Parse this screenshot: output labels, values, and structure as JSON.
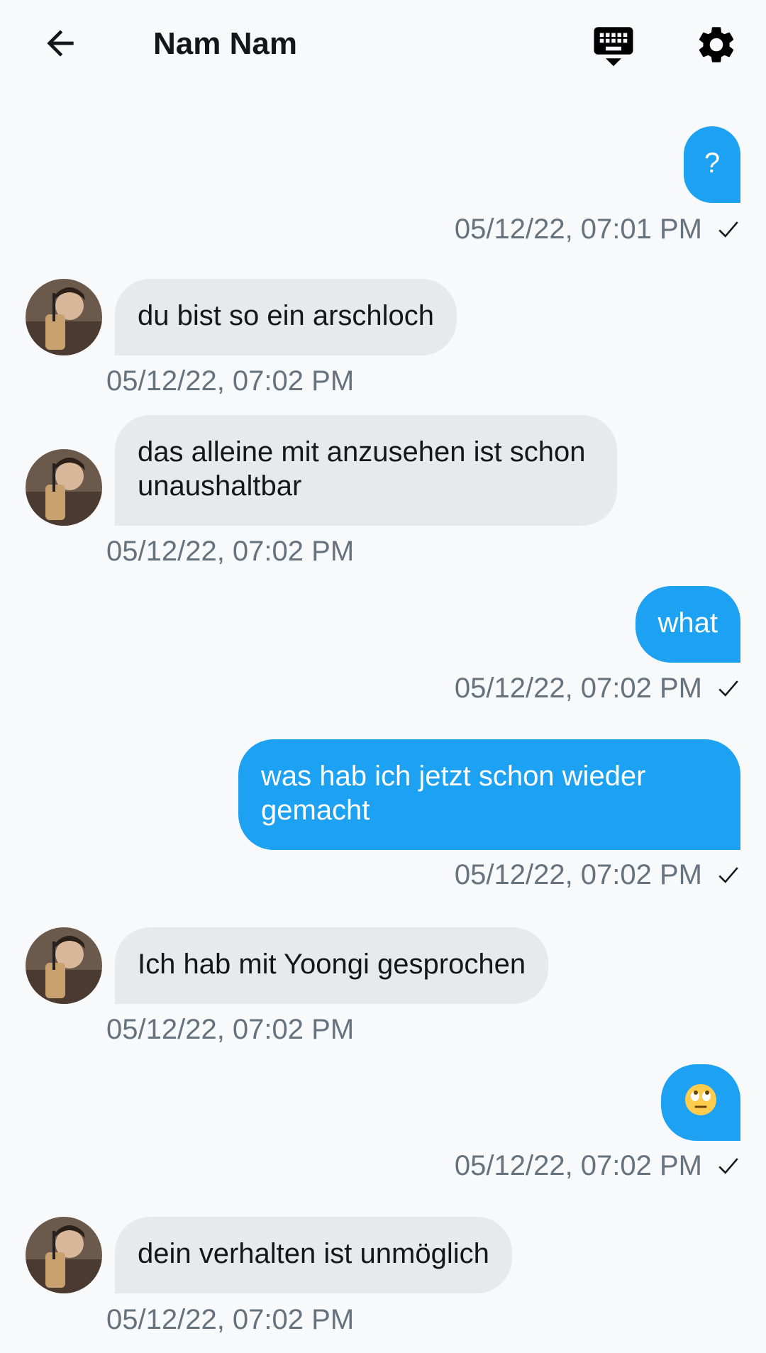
{
  "header": {
    "title": "Nam Nam",
    "back_icon": "arrow-left-icon",
    "keyboard_icon": "keyboard-hide-icon",
    "settings_icon": "gear-icon"
  },
  "colors": {
    "accent": "#1DA1F2",
    "incoming_bubble": "#E6EAED",
    "timestamp": "#66727E",
    "background": "#F7F9FA"
  },
  "messages": [
    {
      "direction": "out",
      "text": "?",
      "timestamp": "05/12/22, 07:01 PM",
      "sent": true
    },
    {
      "direction": "in",
      "text": "du bist so ein arschloch",
      "timestamp": "05/12/22, 07:02 PM"
    },
    {
      "direction": "in",
      "text": "das alleine mit anzusehen ist schon unaushaltbar",
      "timestamp": "05/12/22, 07:02 PM"
    },
    {
      "direction": "out",
      "text": "what",
      "timestamp": "05/12/22, 07:02 PM",
      "sent": true
    },
    {
      "direction": "out",
      "text": "was hab ich jetzt schon wieder gemacht",
      "timestamp": "05/12/22, 07:02 PM",
      "sent": true
    },
    {
      "direction": "in",
      "text": "Ich hab mit Yoongi gesprochen",
      "timestamp": "05/12/22, 07:02 PM"
    },
    {
      "direction": "out",
      "text": "🙄",
      "timestamp": "05/12/22, 07:02 PM",
      "sent": true
    },
    {
      "direction": "in",
      "text": "dein verhalten ist unmöglich",
      "timestamp": "05/12/22, 07:02 PM"
    }
  ]
}
